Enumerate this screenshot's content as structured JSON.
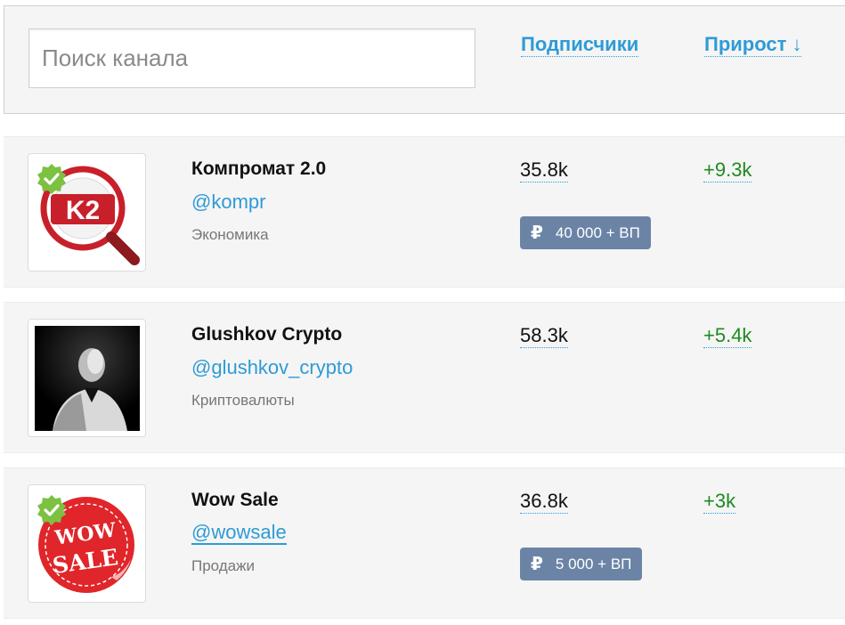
{
  "search": {
    "placeholder": "Поиск канала"
  },
  "columns": {
    "subscribers": "Подписчики",
    "growth": "Прирост ↓"
  },
  "colors": {
    "accent": "#2e9bd6",
    "growth": "#1f8a1f",
    "price_bg": "#6b84a6",
    "verified": "#7cc142"
  },
  "channels": [
    {
      "name": "Компромат 2.0",
      "handle": "@kompr",
      "category": "Экономика",
      "subscribers": "35.8k",
      "growth": "+9.3k",
      "price": "40 000 + ВП",
      "currency_symbol": "₽",
      "verified": true,
      "avatar_icon": "k2-magnifier-logo",
      "avatar_text": "K2"
    },
    {
      "name": "Glushkov Crypto",
      "handle": "@glushkov_crypto",
      "category": "Криптовалюты",
      "subscribers": "58.3k",
      "growth": "+5.4k",
      "verified": false,
      "avatar_icon": "portrait-photo"
    },
    {
      "name": "Wow Sale",
      "handle": "@wowsale",
      "category": "Продажи",
      "subscribers": "36.8k",
      "growth": "+3k",
      "price": "5 000 + ВП",
      "currency_symbol": "₽",
      "verified": true,
      "avatar_icon": "wow-sale-sticker-logo",
      "avatar_text_top": "WOW",
      "avatar_text_bottom": "SALE"
    }
  ]
}
